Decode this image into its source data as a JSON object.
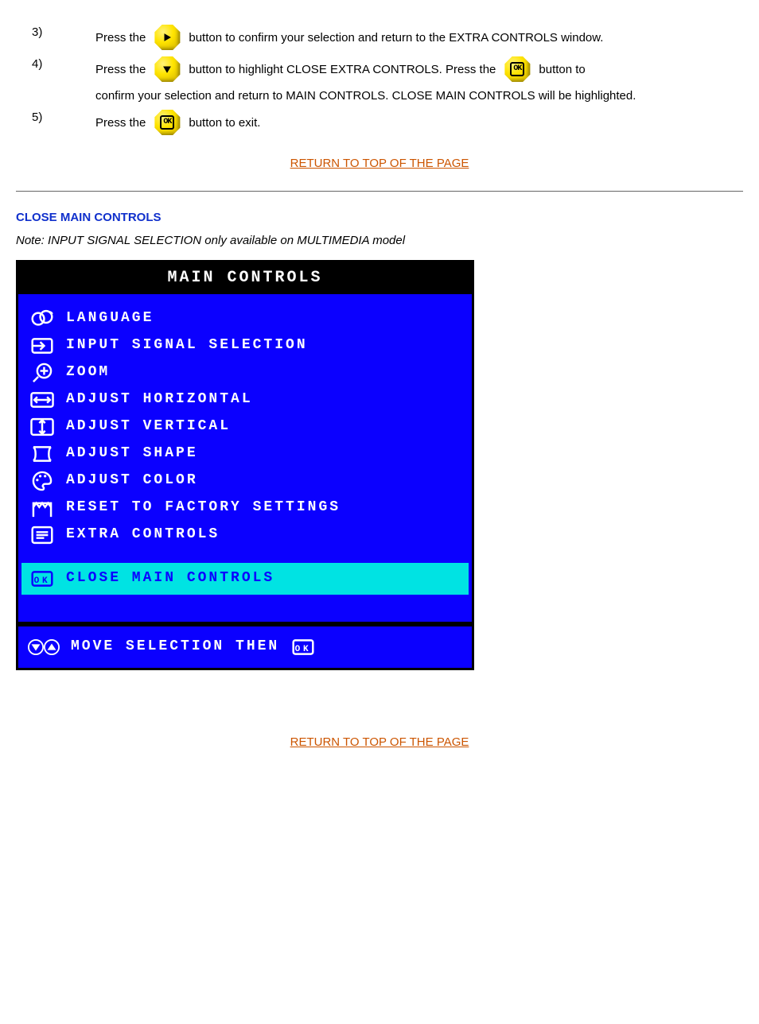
{
  "steps": {
    "s3_num": "3)",
    "s3a": "Press the ",
    "s3b": " button to confirm your selection and return to the EXTRA CONTROLS window.",
    "s4_num": "4)",
    "s4a": "Press the ",
    "s4b": " button to highlight CLOSE EXTRA CONTROLS. Press the ",
    "s4c": " button to",
    "s5a": "confirm your selection and return to MAIN CONTROLS. CLOSE MAIN CONTROLS will be highlighted.",
    "s6_num": "5)",
    "s6a": "Press the ",
    "s6b": " button to exit."
  },
  "returnLink": "RETURN TO TOP OF THE PAGE",
  "closeTitle": "CLOSE MAIN CONTROLS",
  "noteLabel": "Note:",
  "noteBody": " INPUT SIGNAL SELECTION only available on MULTIMEDIA model",
  "osd": {
    "title": "MAIN CONTROLS",
    "items": [
      "LANGUAGE",
      "INPUT SIGNAL SELECTION",
      "ZOOM",
      "ADJUST HORIZONTAL",
      "ADJUST VERTICAL",
      "ADJUST SHAPE",
      "ADJUST COLOR",
      "RESET TO FACTORY SETTINGS",
      "EXTRA CONTROLS"
    ],
    "highlightItem": "CLOSE MAIN CONTROLS",
    "footer": "MOVE SELECTION THEN"
  }
}
